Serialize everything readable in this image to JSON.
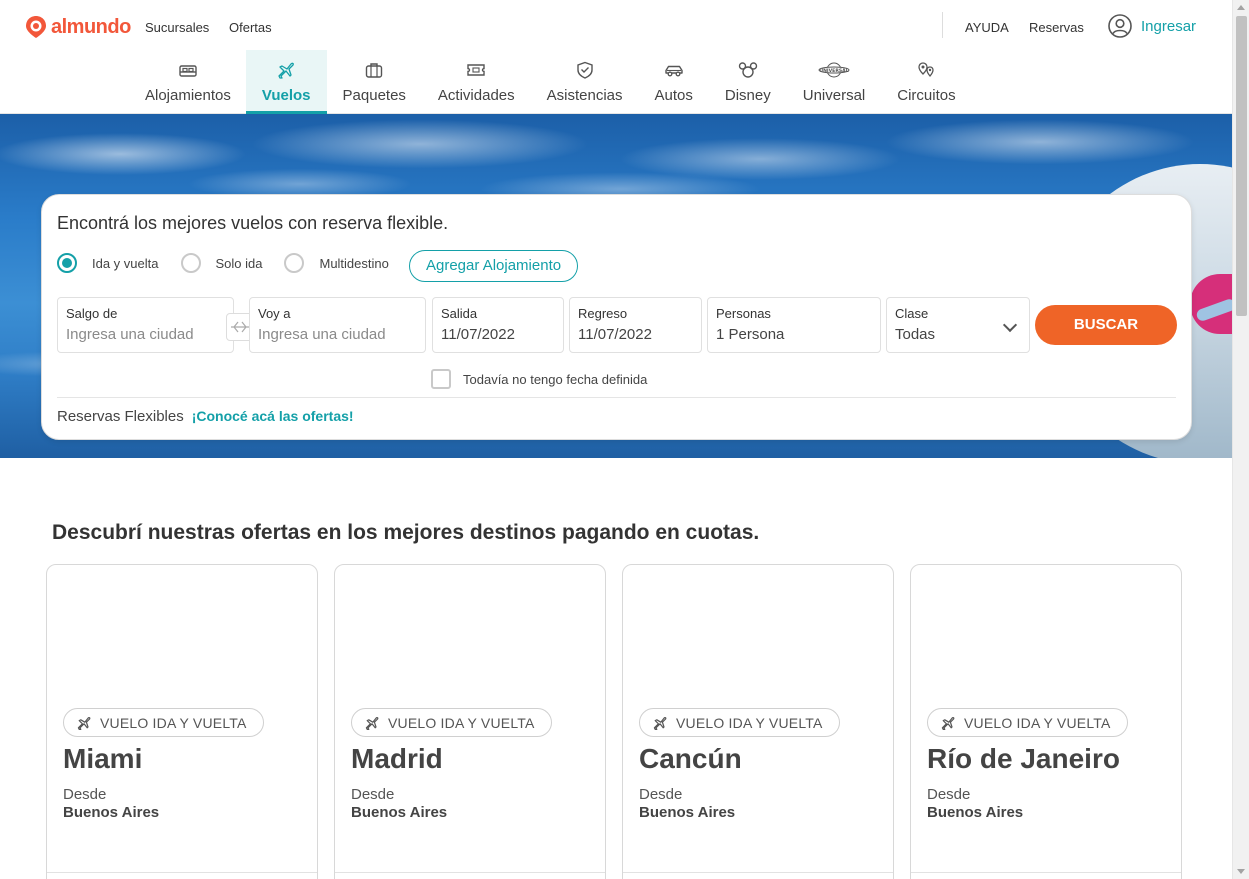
{
  "brand": {
    "name": "almundo",
    "color": "#f2573a",
    "accent": "#14a0a8",
    "cta": "#ef6427"
  },
  "header": {
    "links_left": [
      "Sucursales",
      "Ofertas"
    ],
    "help": "AYUDA",
    "reservas": "Reservas",
    "login": "Ingresar"
  },
  "tabs": [
    {
      "label": "Alojamientos",
      "icon": "bed-icon",
      "active": false
    },
    {
      "label": "Vuelos",
      "icon": "plane-icon",
      "active": true
    },
    {
      "label": "Paquetes",
      "icon": "suitcase-icon",
      "active": false
    },
    {
      "label": "Actividades",
      "icon": "ticket-icon",
      "active": false
    },
    {
      "label": "Asistencias",
      "icon": "shield-icon",
      "active": false
    },
    {
      "label": "Autos",
      "icon": "car-icon",
      "active": false
    },
    {
      "label": "Disney",
      "icon": "mickey-icon",
      "active": false
    },
    {
      "label": "Universal",
      "icon": "universal-globe-icon",
      "active": false
    },
    {
      "label": "Circuitos",
      "icon": "map-pins-icon",
      "active": false
    }
  ],
  "search": {
    "title": "Encontrá los mejores vuelos con reserva flexible.",
    "trip_types": [
      {
        "label": "Ida y vuelta",
        "selected": true
      },
      {
        "label": "Solo ida",
        "selected": false
      },
      {
        "label": "Multidestino",
        "selected": false
      }
    ],
    "add_lodging": "Agregar Alojamiento",
    "origin": {
      "label": "Salgo de",
      "placeholder": "Ingresa una ciudad"
    },
    "destination": {
      "label": "Voy a",
      "placeholder": "Ingresa una ciudad"
    },
    "departure": {
      "label": "Salida",
      "value": "11/07/2022"
    },
    "return": {
      "label": "Regreso",
      "value": "11/07/2022"
    },
    "people": {
      "label": "Personas",
      "value": "1 Persona"
    },
    "class": {
      "label": "Clase",
      "value": "Todas"
    },
    "submit": "BUSCAR",
    "no_date": "Todavía no tengo fecha definida",
    "flex_label": "Reservas Flexibles",
    "flex_link": "¡Conocé acá las ofertas!"
  },
  "offers": {
    "title": "Descubrí nuestras ofertas en los mejores destinos pagando en cuotas.",
    "items": [
      {
        "badge": "VUELO IDA Y VUELTA",
        "city": "Miami",
        "desde": "Desde",
        "origin": "Buenos Aires"
      },
      {
        "badge": "VUELO IDA Y VUELTA",
        "city": "Madrid",
        "desde": "Desde",
        "origin": "Buenos Aires"
      },
      {
        "badge": "VUELO IDA Y VUELTA",
        "city": "Cancún",
        "desde": "Desde",
        "origin": "Buenos Aires"
      },
      {
        "badge": "VUELO IDA Y VUELTA",
        "city": "Río de Janeiro",
        "desde": "Desde",
        "origin": "Buenos Aires"
      }
    ]
  }
}
